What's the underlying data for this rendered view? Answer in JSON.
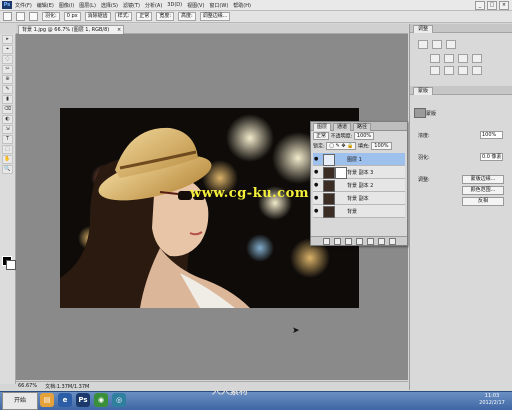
{
  "menubar": {
    "logo": "Ps",
    "items": [
      "文件(F)",
      "编辑(E)",
      "图像(I)",
      "图层(L)",
      "选择(S)",
      "滤镜(T)",
      "分析(A)",
      "3D(D)",
      "视图(V)",
      "窗口(W)",
      "帮助(H)"
    ],
    "window_buttons": [
      "_",
      "□",
      "×"
    ]
  },
  "optbar": {
    "feather_label": "羽化:",
    "feather_value": "0 px",
    "antialias_label": "消除锯齿",
    "style_label": "样式:",
    "style_value": "正常",
    "width_label": "宽度:",
    "height_label": "高度:",
    "refine_label": "调整边缘..."
  },
  "document_tab": {
    "title": "背景 1.jpg @ 66.7% (图层 1, RGB/8)",
    "close": "×"
  },
  "tools": [
    "▸",
    "⌖",
    "◌",
    "✂",
    "⊕",
    "✎",
    "▮",
    "⌫",
    "◐",
    "⇲",
    "T",
    "⬚",
    "✋",
    "🔍"
  ],
  "photo": {
    "watermark": "www.cg-ku.com"
  },
  "statusbar": {
    "zoom": "66.67%",
    "doc": "文档:1.37M/1.37M"
  },
  "right_panel": {
    "top_tab": "调整",
    "masks_tab": "蒙版",
    "mask_title": "像素蒙版",
    "density_label": "浓度:",
    "density_value": "100%",
    "feather_label": "羽化:",
    "feather_value": "0.0 像素",
    "refine_label": "调整:",
    "mask_edge_button": "蒙版边缘...",
    "color_range_button": "颜色范围...",
    "invert_button": "反相"
  },
  "layers_panel": {
    "tabs": [
      "图层",
      "通道",
      "路径"
    ],
    "blend_mode": "正常",
    "opacity_label": "不透明度:",
    "opacity_value": "100%",
    "lock_label": "锁定:",
    "fill_label": "填充:",
    "fill_value": "100%",
    "layers": [
      {
        "name": "图层 1",
        "selected": true,
        "has_mask": false
      },
      {
        "name": "背景 副本 3",
        "selected": false,
        "has_mask": true
      },
      {
        "name": "背景 副本 2",
        "selected": false,
        "has_mask": false
      },
      {
        "name": "背景 副本",
        "selected": false,
        "has_mask": false
      },
      {
        "name": "背景",
        "selected": false,
        "has_mask": false
      }
    ]
  },
  "taskbar": {
    "start": "开始",
    "brand_watermark": "人人素材",
    "clock_time": "11:03",
    "clock_date": "2012/2/17"
  }
}
